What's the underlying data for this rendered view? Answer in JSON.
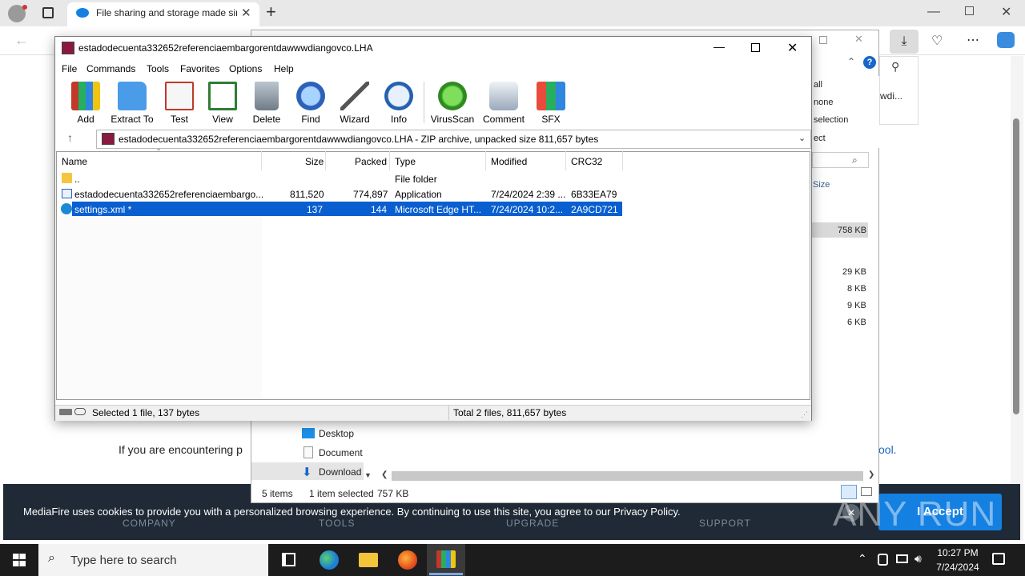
{
  "browser": {
    "tab_title": "File sharing and storage made simple",
    "new_tab": "+"
  },
  "page": {
    "encounter_text": "If you are encountering p",
    "ool_text": "ool.",
    "cookie_text": "MediaFire uses cookies to provide you with a personalized browsing experience. By continuing to use this site, you agree to our Privacy Policy.",
    "accept_label": "I Accept",
    "footer": [
      "COMPANY",
      "TOOLS",
      "UPGRADE",
      "SUPPORT"
    ],
    "watermark": "ANY RUN"
  },
  "explorer": {
    "opt_all": "all",
    "opt_none": "none",
    "opt_selection": "selection",
    "opt_ect": "ect",
    "size_hdr": "Size",
    "sizes": [
      "758 KB",
      "29 KB",
      "8 KB",
      "9 KB",
      "6 KB"
    ],
    "nav": [
      "Desktop",
      "Document",
      "Download"
    ],
    "status_items": "5 items",
    "status_selected": "1 item selected",
    "status_size": "757 KB",
    "right_text": "wdi..."
  },
  "winrar": {
    "title": "estadodecuenta332652referenciaembargorentdawwwdiangovco.LHA",
    "menu": [
      "File",
      "Commands",
      "Tools",
      "Favorites",
      "Options",
      "Help"
    ],
    "toolbar": [
      "Add",
      "Extract To",
      "Test",
      "View",
      "Delete",
      "Find",
      "Wizard",
      "Info",
      "VirusScan",
      "Comment",
      "SFX"
    ],
    "path": "estadodecuenta332652referenciaembargorentdawwwdiangovco.LHA - ZIP archive, unpacked size 811,657 bytes",
    "columns": [
      "Name",
      "Size",
      "Packed",
      "Type",
      "Modified",
      "CRC32"
    ],
    "rows": [
      {
        "name": "..",
        "size": "",
        "packed": "",
        "type": "File folder",
        "modified": "",
        "crc": ""
      },
      {
        "name": "estadodecuenta332652referenciaembargo...",
        "size": "811,520",
        "packed": "774,897",
        "type": "Application",
        "modified": "7/24/2024 2:39 ...",
        "crc": "6B33EA79"
      },
      {
        "name": "settings.xml *",
        "size": "137",
        "packed": "144",
        "type": "Microsoft Edge HT...",
        "modified": "7/24/2024 10:2...",
        "crc": "2A9CD721"
      }
    ],
    "status_left": "Selected 1 file, 137 bytes",
    "status_right": "Total 2 files, 811,657 bytes"
  },
  "taskbar": {
    "search_placeholder": "Type here to search",
    "time": "10:27 PM",
    "date": "7/24/2024"
  }
}
